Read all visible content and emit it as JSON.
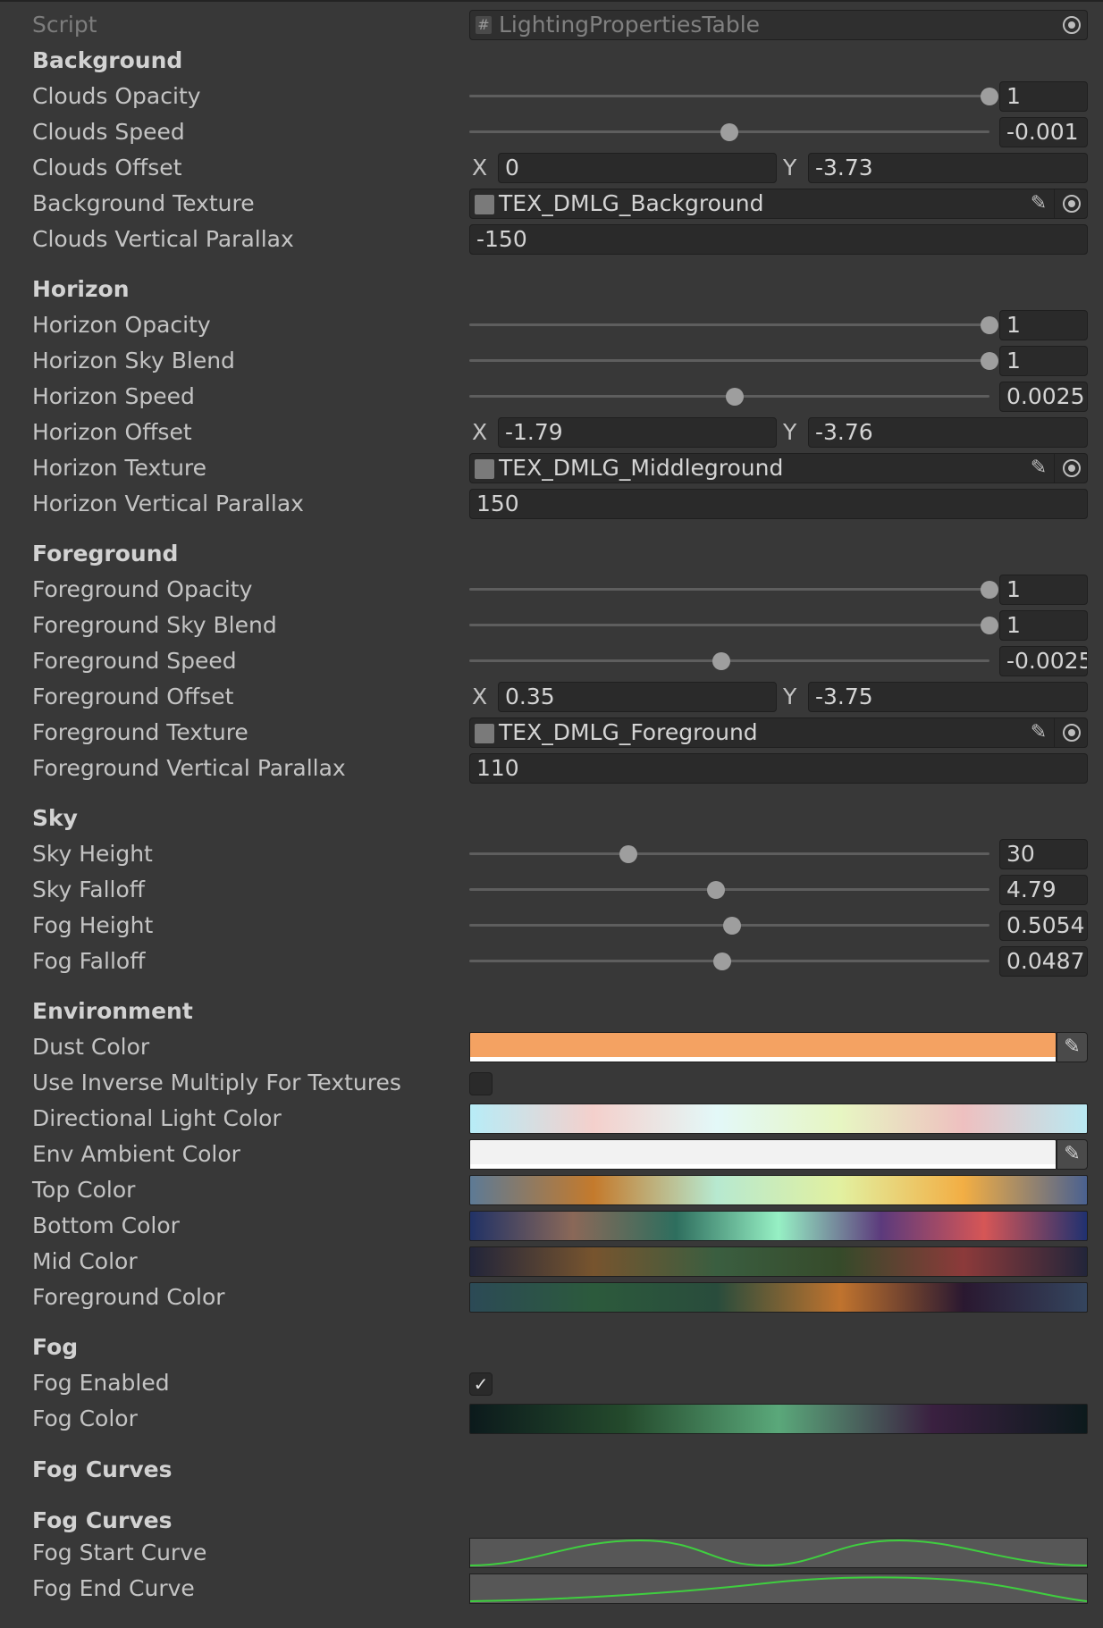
{
  "script": {
    "label": "Script",
    "value": "LightingPropertiesTable"
  },
  "sections": {
    "background": "Background",
    "horizon": "Horizon",
    "foreground": "Foreground",
    "sky": "Sky",
    "environment": "Environment",
    "fog": "Fog",
    "fog_curves_1": "Fog Curves",
    "fog_curves_2": "Fog Curves"
  },
  "background": {
    "clouds_opacity": {
      "label": "Clouds Opacity",
      "value": "1",
      "fraction": 1.0
    },
    "clouds_speed": {
      "label": "Clouds Speed",
      "value": "-0.001",
      "fraction": 0.5
    },
    "clouds_offset": {
      "label": "Clouds Offset",
      "x_label": "X",
      "x": "0",
      "y_label": "Y",
      "y": "-3.73"
    },
    "background_texture": {
      "label": "Background Texture",
      "value": "TEX_DMLG_Background"
    },
    "clouds_vertical_parallax": {
      "label": "Clouds Vertical Parallax",
      "value": "-150"
    }
  },
  "horizon": {
    "horizon_opacity": {
      "label": "Horizon Opacity",
      "value": "1",
      "fraction": 1.0
    },
    "horizon_sky_blend": {
      "label": "Horizon Sky Blend",
      "value": "1",
      "fraction": 1.0
    },
    "horizon_speed": {
      "label": "Horizon Speed",
      "value": "0.0025",
      "fraction": 0.51
    },
    "horizon_offset": {
      "label": "Horizon Offset",
      "x_label": "X",
      "x": "-1.79",
      "y_label": "Y",
      "y": "-3.76"
    },
    "horizon_texture": {
      "label": "Horizon Texture",
      "value": "TEX_DMLG_Middleground"
    },
    "horizon_vertical_parallax": {
      "label": "Horizon Vertical Parallax",
      "value": "150"
    }
  },
  "foreground": {
    "foreground_opacity": {
      "label": "Foreground Opacity",
      "value": "1",
      "fraction": 1.0
    },
    "foreground_sky_blend": {
      "label": "Foreground Sky Blend",
      "value": "1",
      "fraction": 1.0
    },
    "foreground_speed": {
      "label": "Foreground Speed",
      "value": "-0.0025",
      "fraction": 0.485
    },
    "foreground_offset": {
      "label": "Foreground Offset",
      "x_label": "X",
      "x": "0.35",
      "y_label": "Y",
      "y": "-3.75"
    },
    "foreground_texture": {
      "label": "Foreground Texture",
      "value": "TEX_DMLG_Foreground"
    },
    "foreground_vertical_parallax": {
      "label": "Foreground Vertical Parallax",
      "value": "110"
    }
  },
  "sky": {
    "sky_height": {
      "label": "Sky Height",
      "value": "30",
      "fraction": 0.305
    },
    "sky_falloff": {
      "label": "Sky Falloff",
      "value": "4.79",
      "fraction": 0.475
    },
    "fog_height": {
      "label": "Fog Height",
      "value": "0.5054",
      "fraction": 0.505
    },
    "fog_falloff": {
      "label": "Fog Falloff",
      "value": "0.0487",
      "fraction": 0.487
    }
  },
  "environment": {
    "dust_color": {
      "label": "Dust Color",
      "color": "#f4a262"
    },
    "use_inverse_multiply": {
      "label": "Use Inverse Multiply For Textures",
      "checked": false
    },
    "directional_light_color": {
      "label": "Directional Light Color",
      "gradient": [
        "#b7ecf7",
        "#f4d0cc",
        "#e3f8f8",
        "#e7f6c2",
        "#eec0c0",
        "#b9e9f2"
      ]
    },
    "env_ambient_color": {
      "label": "Env Ambient Color",
      "color": "#f2f2f2"
    },
    "top_color": {
      "label": "Top Color",
      "gradient": [
        "#5d7a95",
        "#c47a2c",
        "#b7e9d0",
        "#e2f0a0",
        "#f2ae44",
        "#4a6190"
      ]
    },
    "bottom_color": {
      "label": "Bottom Color",
      "gradient": [
        "#213266",
        "#8a6858",
        "#2e6e5e",
        "#96f0c4",
        "#5c3a7c",
        "#d65656",
        "#203170"
      ]
    },
    "mid_color": {
      "label": "Mid Color",
      "gradient": [
        "#22253a",
        "#77542e",
        "#3a5e40",
        "#364a2a",
        "#8c3a3a",
        "#22253a"
      ]
    },
    "foreground_color": {
      "label": "Foreground Color",
      "gradient": [
        "#2c4a56",
        "#2c5a3c",
        "#294c3c",
        "#c0732e",
        "#2a1830",
        "#34455e"
      ]
    }
  },
  "fog": {
    "fog_enabled": {
      "label": "Fog Enabled",
      "checked": true
    },
    "fog_color": {
      "label": "Fog Color",
      "gradient": [
        "#0c1a1c",
        "#244a2c",
        "#5aa87a",
        "#3a2040",
        "#0c1a1c"
      ]
    }
  },
  "fog_curves": {
    "fog_start_curve": {
      "label": "Fog Start Curve"
    },
    "fog_end_curve": {
      "label": "Fog End Curve"
    }
  }
}
